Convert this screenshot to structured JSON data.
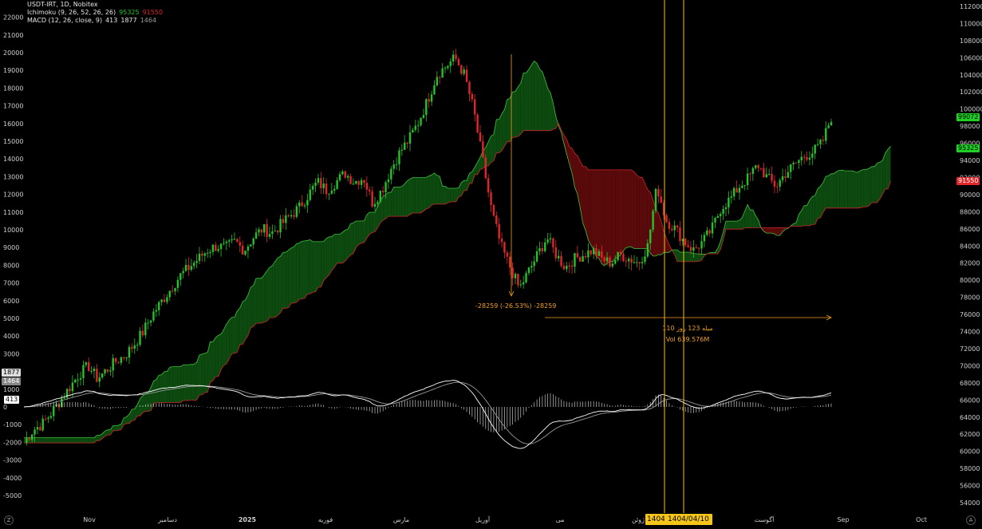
{
  "header": {
    "symbol_line": "USDT-IRT, 1D, Nobitex",
    "ichimoku_label": "Ichimoku (9, 26, 52, 26, 26)",
    "ichimoku_val_green": "95325",
    "ichimoku_val_red": "91550",
    "macd_label": "MACD (12, 26, close, 9)",
    "macd_v1": "413",
    "macd_v2": "1877",
    "macd_v3": "1464"
  },
  "colors": {
    "up": "#26c22a",
    "down": "#e0262a",
    "cloud_bull": "#0d4a10",
    "cloud_bear": "#5a0a0a",
    "annotation": "#f0a020",
    "crosshair": "#f5c518",
    "macd": "#ffffff",
    "signal": "#9a9a9a"
  },
  "annotations": {
    "measure_left": "-28259 (-26.53%) -28259",
    "measure_days": "110 میله 123 روز",
    "measure_vol": "Vol 639.576M",
    "crosshair_date": "1404/04/10",
    "crosshair_year": "1404"
  },
  "tags": {
    "price_last": "99072",
    "price_green": "95325",
    "price_red": "91550",
    "macd_1877": "1877",
    "macd_1464": "1464",
    "macd_413": "413"
  },
  "chart_data": {
    "type": "candlestick",
    "title": "USDT-IRT, 1D, Nobitex",
    "right_axis": {
      "ticks": [
        112000,
        110000,
        108000,
        106000,
        104000,
        102000,
        100000,
        98000,
        96000,
        94000,
        92000,
        90000,
        88000,
        86000,
        84000,
        82000,
        80000,
        78000,
        76000,
        74000,
        72000,
        70000,
        68000,
        66000,
        64000,
        62000,
        60000,
        58000,
        56000,
        54000
      ]
    },
    "left_axis": {
      "ticks": [
        22000,
        21000,
        20000,
        19000,
        18000,
        17000,
        16000,
        15000,
        14000,
        13000,
        12000,
        11000,
        10000,
        9000,
        8000,
        7000,
        6000,
        5000,
        4000,
        3000,
        2000,
        1000,
        0,
        -1000,
        -2000,
        -3000,
        -4000,
        -5000
      ]
    },
    "x_ticks": [
      "Nov",
      "دسامبر",
      "2025",
      "فوریه",
      "مارس",
      "آوریل",
      "می",
      "ژوئن",
      "آگوست",
      "Sep",
      "Oct"
    ],
    "price_series": [
      61000,
      62500,
      63200,
      64500,
      66000,
      67500,
      69000,
      70000,
      68500,
      69500,
      70500,
      71200,
      72500,
      74000,
      76000,
      77500,
      79000,
      80500,
      81500,
      82500,
      83500,
      84000,
      83800,
      84500,
      83500,
      85000,
      86000,
      85500,
      86500,
      87500,
      88500,
      90000,
      91500,
      90500,
      91500,
      92500,
      91500,
      92000,
      89000,
      90500,
      93000,
      95000,
      96500,
      98500,
      101000,
      104000,
      105000,
      106000,
      104000,
      100000,
      94000,
      88000,
      84000,
      81500,
      79000,
      81000,
      83000,
      85000,
      83000,
      81500,
      82500,
      83000,
      83500,
      82500,
      82000,
      83000,
      82500,
      82000,
      84000,
      91000,
      87000,
      86000,
      84500,
      83500,
      84500,
      86000,
      88500,
      89500,
      91000,
      92000,
      93500,
      92000,
      91000,
      92500,
      93500,
      94500,
      95000,
      96000,
      99072
    ],
    "ichimoku": {
      "lead1_last": 95325,
      "lead2_last": 91550
    },
    "macd": {
      "macd": 1877,
      "signal": 1464,
      "histogram": 413
    },
    "measure": {
      "change": -28259,
      "change_pct": -26.53,
      "bars": 110,
      "days": 123,
      "volume": "639.576M"
    }
  }
}
